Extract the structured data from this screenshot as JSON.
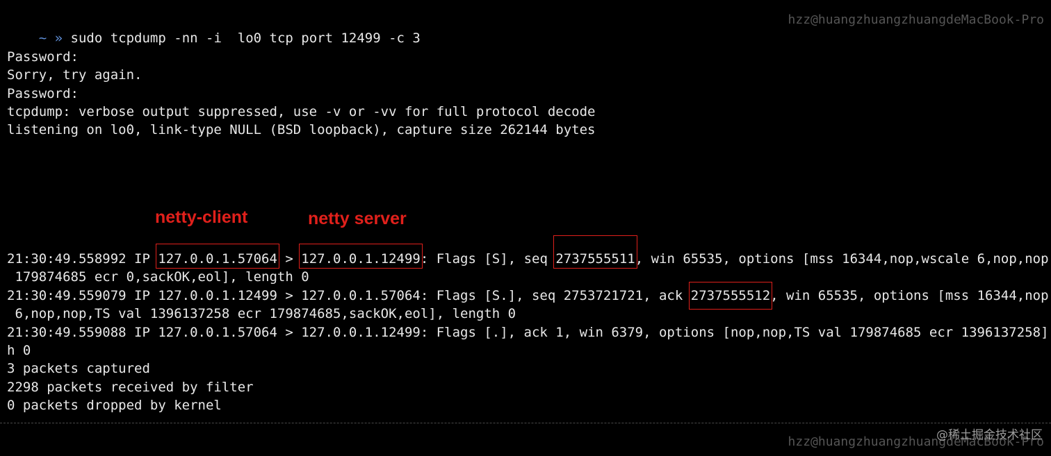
{
  "prompt": {
    "symbol": "~ »",
    "command": "sudo tcpdump -nn -i  lo0 tcp port 12499 -c 3",
    "host": "hzz@huangzhuangzhuangdeMacBook-Pro"
  },
  "output": {
    "password1": "Password:",
    "sorry": "Sorry, try again.",
    "password2": "Password:",
    "verbose": "tcpdump: verbose output suppressed, use -v or -vv for full protocol decode",
    "listening": "listening on lo0, link-type NULL (BSD loopback), capture size 262144 bytes"
  },
  "annotations": {
    "client": "netty-client",
    "server": "netty server"
  },
  "packets": {
    "p1": {
      "prefix": "21:30:49.558992 IP ",
      "src": "127.0.0.1.57064",
      "mid": " > ",
      "dst": "127.0.0.1.12499",
      "pre_seq": ": Flags [S], seq ",
      "seq": "2737555511",
      "rest": ", win 65535, options [mss 16344,nop,wscale 6,nop,nop,TS val",
      "wrap": " 179874685 ecr 0,sackOK,eol], length 0"
    },
    "p2": {
      "pre_ack": "21:30:49.559079 IP 127.0.0.1.12499 > 127.0.0.1.57064: Flags [S.], seq 2753721721, ack ",
      "ack": "2737555512",
      "rest": ", win 65535, options [mss 16344,nop,wscale",
      "wrap": " 6,nop,nop,TS val 1396137258 ecr 179874685,sackOK,eol], length 0"
    },
    "p3": {
      "line": "21:30:49.559088 IP 127.0.0.1.57064 > 127.0.0.1.12499: Flags [.], ack 1, win 6379, options [nop,nop,TS val 179874685 ecr 1396137258], lengt",
      "wrap": "h 0"
    }
  },
  "summary": {
    "captured": "3 packets captured",
    "received": "2298 packets received by filter",
    "dropped": "0 packets dropped by kernel"
  },
  "prompt2": {
    "symbol": "~ »",
    "host": "hzz@huangzhuangzhuangdeMacBook-Pro"
  },
  "watermark": "@稀土掘金技术社区",
  "colors": {
    "background": "#000000",
    "text": "#e8e8e8",
    "prompt_arrow": "#5f8fd8",
    "annotation": "#e0201b",
    "host": "#555555"
  }
}
